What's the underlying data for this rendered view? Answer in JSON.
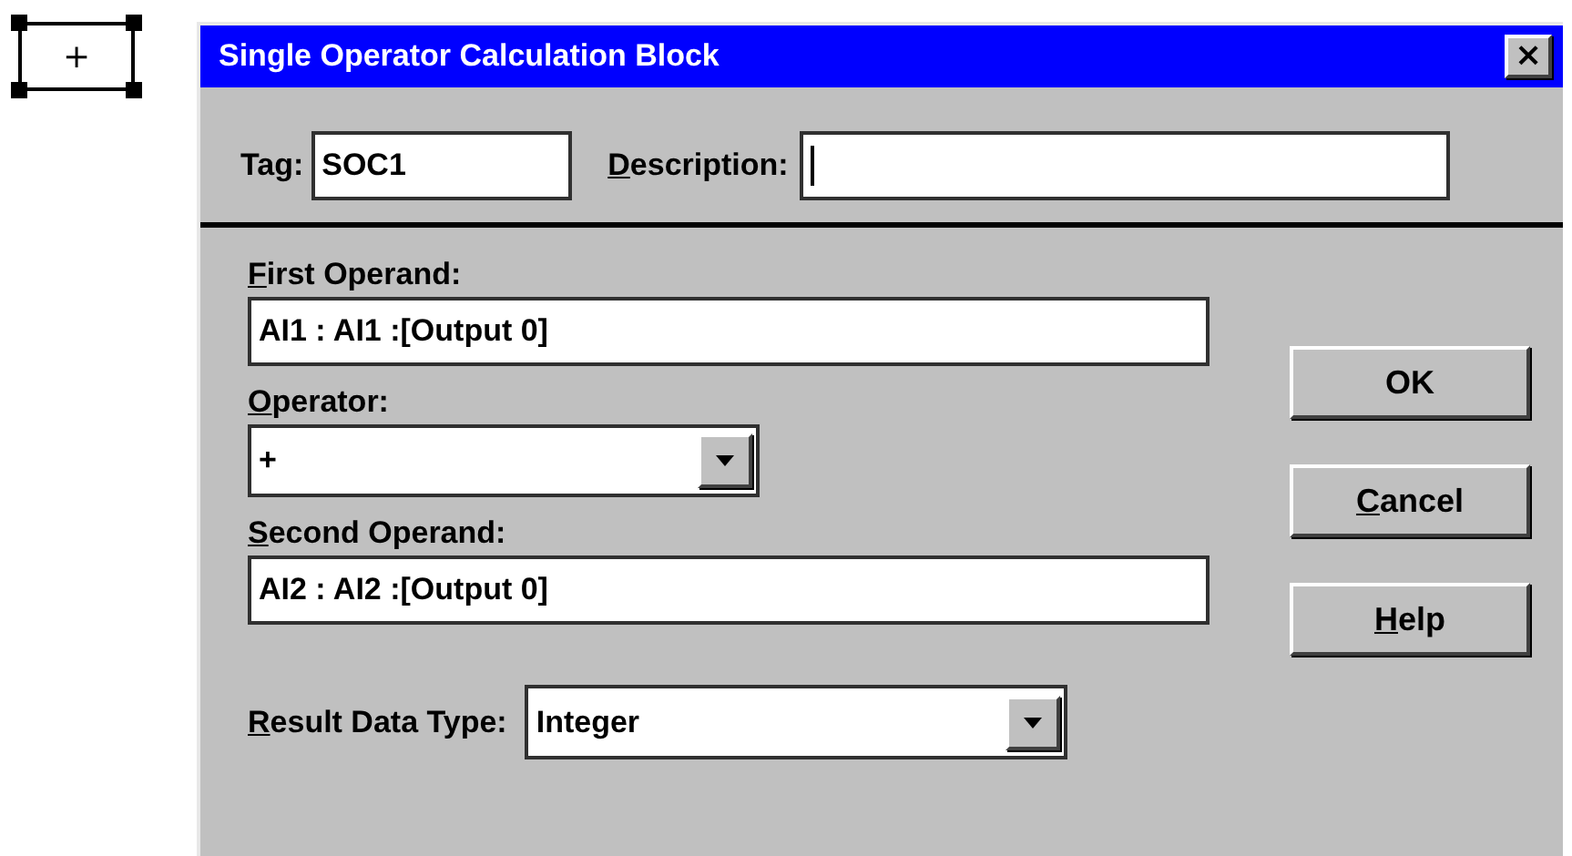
{
  "block_symbol": {
    "label": "+"
  },
  "window": {
    "title": "Single Operator Calculation Block",
    "close": "×"
  },
  "tag": {
    "label": {
      "rest": "Tag:"
    },
    "value": "SOC1"
  },
  "description": {
    "label": {
      "accel": "D",
      "rest": "escription:"
    },
    "focused": true
  },
  "first_operand": {
    "label": {
      "accel": "F",
      "rest": "irst Operand:"
    },
    "value": "AI1 : AI1 :[Output 0]"
  },
  "operator": {
    "label": {
      "accel": "O",
      "rest": "perator:"
    },
    "value": "+"
  },
  "second_operand": {
    "label": {
      "accel": "S",
      "rest": "econd Operand:"
    },
    "value": "AI2 : AI2 :[Output 0]"
  },
  "result_data_type": {
    "label": {
      "accel": "R",
      "rest": "esult Data Type:"
    },
    "value": "Integer"
  },
  "buttons": [
    {
      "rest": "OK"
    },
    {
      "accel": "C",
      "rest": "ancel"
    },
    {
      "accel": "H",
      "rest": "elp"
    }
  ]
}
